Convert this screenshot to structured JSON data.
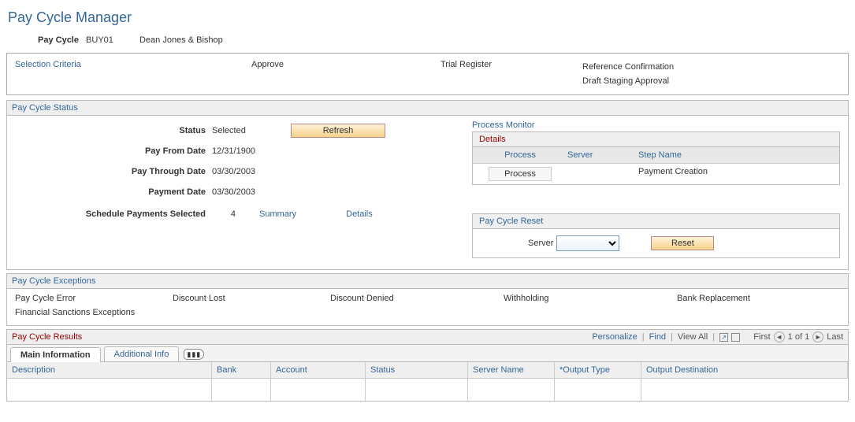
{
  "page_title": "Pay Cycle Manager",
  "header": {
    "paycycle_label": "Pay Cycle",
    "paycycle_id": "BUY01",
    "paycycle_name": "Dean Jones & Bishop"
  },
  "selection_row": {
    "selection_criteria": "Selection Criteria",
    "approve": "Approve",
    "trial_register": "Trial Register",
    "reference_confirmation": "Reference Confirmation",
    "draft_staging_approval": "Draft Staging Approval"
  },
  "status": {
    "group_title": "Pay Cycle Status",
    "labels": {
      "status": "Status",
      "pay_from": "Pay From Date",
      "pay_through": "Pay Through Date",
      "payment_date": "Payment Date",
      "schedule_payments": "Schedule Payments Selected"
    },
    "values": {
      "status": "Selected",
      "pay_from": "12/31/1900",
      "pay_through": "03/30/2003",
      "payment_date": "03/30/2003",
      "schedule_payments": "4"
    },
    "refresh_button": "Refresh",
    "summary_link": "Summary",
    "details_link": "Details",
    "process_monitor_link": "Process Monitor",
    "details_box": {
      "title": "Details",
      "headers": {
        "process": "Process",
        "server": "Server",
        "step": "Step Name"
      },
      "row": {
        "process_button": "Process",
        "server": "",
        "step": "Payment Creation"
      }
    },
    "reset_box": {
      "title": "Pay Cycle Reset",
      "server_label": "Server",
      "server_value": "",
      "reset_button": "Reset"
    }
  },
  "exceptions": {
    "group_title": "Pay Cycle Exceptions",
    "links": {
      "pay_cycle_error": "Pay Cycle Error",
      "discount_lost": "Discount Lost",
      "discount_denied": "Discount Denied",
      "withholding": "Withholding",
      "bank_replacement": "Bank Replacement",
      "financial_sanctions": "Financial Sanctions Exceptions"
    }
  },
  "results": {
    "group_title": "Pay Cycle Results",
    "toolbar": {
      "personalize": "Personalize",
      "find": "Find",
      "view_all": "View All",
      "first": "First",
      "counter": "1 of 1",
      "last": "Last"
    },
    "tabs": {
      "main": "Main Information",
      "additional": "Additional Info"
    },
    "columns": {
      "description": "Description",
      "bank": "Bank",
      "account": "Account",
      "status": "Status",
      "server_name": "Server Name",
      "output_type": "*Output Type",
      "output_destination": "Output Destination"
    },
    "row": {
      "description": "",
      "bank": "",
      "account": "",
      "status": "",
      "server_name": "",
      "output_type": "",
      "output_destination": ""
    }
  }
}
